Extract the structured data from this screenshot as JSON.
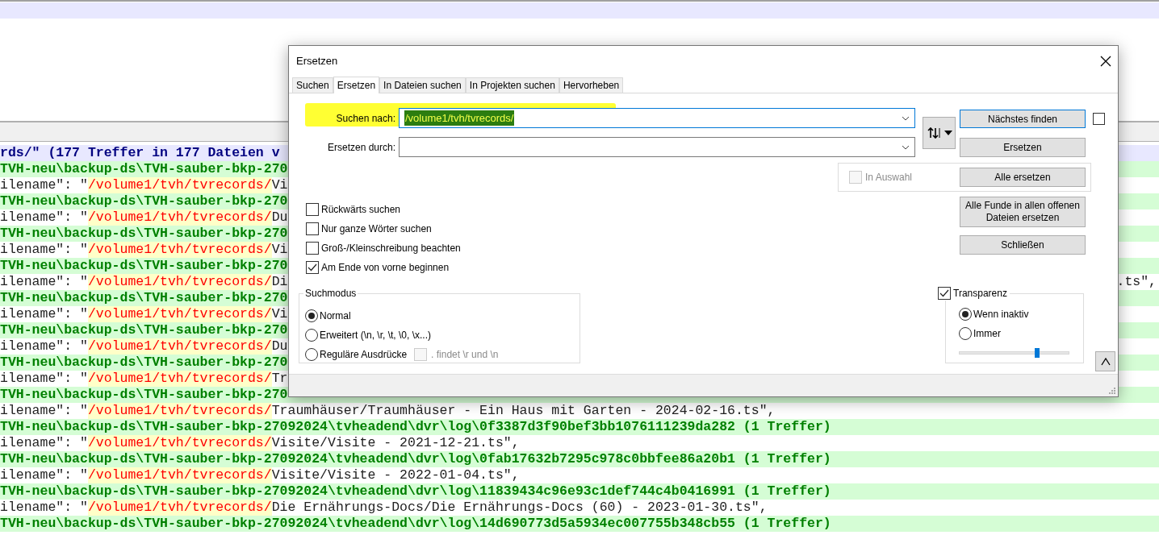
{
  "editor": {
    "lines": [
      {
        "kind": "header",
        "text": "rds/\" (177 Treffer in 177 Dateien v"
      },
      {
        "kind": "file",
        "text": "TVH-neu\\backup-ds\\TVH-sauber-bkp-270"
      },
      {
        "kind": "match",
        "prefix": "ilename\": \"",
        "match": "/volume1/tvh/tvrecords/",
        "rest": "Vi"
      },
      {
        "kind": "file",
        "text": "TVH-neu\\backup-ds\\TVH-sauber-bkp-270"
      },
      {
        "kind": "match",
        "prefix": "ilename\": \"",
        "match": "/volume1/tvh/tvrecords/",
        "rest": "Du"
      },
      {
        "kind": "file",
        "text": "TVH-neu\\backup-ds\\TVH-sauber-bkp-270"
      },
      {
        "kind": "match",
        "prefix": "ilename\": \"",
        "match": "/volume1/tvh/tvrecords/",
        "rest": "Vi"
      },
      {
        "kind": "file",
        "text": "TVH-neu\\backup-ds\\TVH-sauber-bkp-270"
      },
      {
        "kind": "match",
        "prefix": "ilename\": \"",
        "match": "/volume1/tvh/tvrecords/",
        "rest": "Di",
        "tail": ".ts\","
      },
      {
        "kind": "file",
        "text": "TVH-neu\\backup-ds\\TVH-sauber-bkp-270"
      },
      {
        "kind": "match",
        "prefix": "ilename\": \"",
        "match": "/volume1/tvh/tvrecords/",
        "rest": "Vi"
      },
      {
        "kind": "file",
        "text": "TVH-neu\\backup-ds\\TVH-sauber-bkp-270"
      },
      {
        "kind": "match",
        "prefix": "ilename\": \"",
        "match": "/volume1/tvh/tvrecords/",
        "rest": "Du"
      },
      {
        "kind": "file",
        "text": "TVH-neu\\backup-ds\\TVH-sauber-bkp-270"
      },
      {
        "kind": "match",
        "prefix": "ilename\": \"",
        "match": "/volume1/tvh/tvrecords/",
        "rest": "Tr"
      },
      {
        "kind": "file",
        "text": "TVH-neu\\backup-ds\\TVH-sauber-bkp-270"
      },
      {
        "kind": "match",
        "prefix": "ilename\": \"",
        "match": "/volume1/tvh/tvrecords/",
        "rest": "Traumhäuser/Traumhäuser - Ein Haus mit Garten - 2024-02-16.ts\","
      },
      {
        "kind": "file",
        "text": "TVH-neu\\backup-ds\\TVH-sauber-bkp-27092024\\tvheadend\\dvr\\log\\0f3387d3f90bef3bb1076111239da282 (1 Treffer)"
      },
      {
        "kind": "match",
        "prefix": "ilename\": \"",
        "match": "/volume1/tvh/tvrecords/",
        "rest": "Visite/Visite - 2021-12-21.ts\","
      },
      {
        "kind": "file",
        "text": "TVH-neu\\backup-ds\\TVH-sauber-bkp-27092024\\tvheadend\\dvr\\log\\0fab17632b7295c978c0bbfee86a20b1 (1 Treffer)"
      },
      {
        "kind": "match",
        "prefix": "ilename\": \"",
        "match": "/volume1/tvh/tvrecords/",
        "rest": "Visite/Visite - 2022-01-04.ts\","
      },
      {
        "kind": "file",
        "text": "TVH-neu\\backup-ds\\TVH-sauber-bkp-27092024\\tvheadend\\dvr\\log\\11839434c96e93c1def744c4b0416991 (1 Treffer)"
      },
      {
        "kind": "match",
        "prefix": "ilename\": \"",
        "match": "/volume1/tvh/tvrecords/",
        "rest": "Die Ernährungs-Docs/Die Ernährungs-Docs (60) - 2023-01-30.ts\","
      },
      {
        "kind": "file",
        "text": "TVH-neu\\backup-ds\\TVH-sauber-bkp-27092024\\tvheadend\\dvr\\log\\14d690773d5a5934ec007755b348cb55 (1 Treffer)"
      }
    ]
  },
  "dialog": {
    "title": "Ersetzen",
    "tabs": [
      {
        "label": "Suchen",
        "selected": false
      },
      {
        "label": "Ersetzen",
        "selected": true
      },
      {
        "label": "In Dateien suchen",
        "selected": false
      },
      {
        "label": "In Projekten suchen",
        "selected": false
      },
      {
        "label": "Hervorheben",
        "selected": false
      }
    ],
    "search_field": {
      "label": "Suchen nach:",
      "value": "/volume1/tvh/tvrecords/",
      "value_selected": true
    },
    "replace_field": {
      "label": "Ersetzen durch:"
    },
    "find_next_button": {
      "label": "Nächstes finden"
    },
    "side_checkbox": {
      "checked": false
    },
    "replace_button": {
      "label": "Ersetzen"
    },
    "in_selection": {
      "label": "In Auswahl",
      "checked": false,
      "disabled": true
    },
    "replace_all_button": {
      "label": "Alle ersetzen"
    },
    "replace_all_open_button": {
      "label": "Alle Funde in allen offenen Dateien ersetzen"
    },
    "close_button": {
      "label": "Schließen"
    },
    "options": [
      {
        "label": "Rückwärts suchen",
        "checked": false
      },
      {
        "label": "Nur ganze Wörter suchen",
        "checked": false
      },
      {
        "label": "Groß-/Kleinschreibung beachten",
        "checked": false
      },
      {
        "label": "Am Ende von vorne beginnen",
        "checked": true
      }
    ],
    "search_mode": {
      "title": "Suchmodus",
      "modes": [
        {
          "label": "Normal",
          "selected": true
        },
        {
          "label": "Erweitert (\\n, \\r, \\t, \\0, \\x...)",
          "selected": false
        },
        {
          "label": "Reguläre Ausdrücke",
          "selected": false
        }
      ],
      "dot_matches_newline": {
        "label": ". findet \\r und \\n",
        "checked": false,
        "disabled": true
      }
    },
    "transparency": {
      "label": "Transparenz",
      "checked": true,
      "modes": [
        {
          "label": "Wenn inaktiv",
          "selected": true
        },
        {
          "label": "Immer",
          "selected": false
        }
      ],
      "level": 0.71
    }
  }
}
